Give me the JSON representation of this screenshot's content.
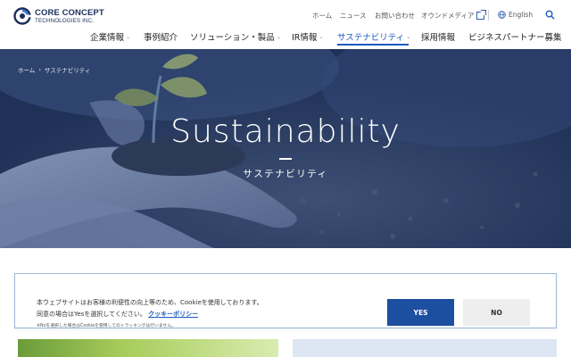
{
  "brand": {
    "line1": "CORE CONCEPT",
    "line2": "TECHNOLOGIES INC.",
    "logo_icon": "cct-logo-mark"
  },
  "utility_nav": {
    "home": "ホーム",
    "news": "ニュース",
    "contact": "お問い合わせ",
    "owned_media": "オウンドメディア",
    "owned_media_icon": "external-link-icon",
    "language": "English",
    "language_icon": "globe-icon",
    "search_icon": "search-icon"
  },
  "global_nav": [
    {
      "label": "企業情報",
      "has_dropdown": true,
      "active": false
    },
    {
      "label": "事例紹介",
      "has_dropdown": false,
      "active": false
    },
    {
      "label": "ソリューション・製品",
      "has_dropdown": true,
      "active": false
    },
    {
      "label": "IR情報",
      "has_dropdown": true,
      "active": false
    },
    {
      "label": "サステナビリティ",
      "has_dropdown": true,
      "active": true
    },
    {
      "label": "採用情報",
      "has_dropdown": false,
      "active": false
    },
    {
      "label": "ビジネスパートナー募集",
      "has_dropdown": false,
      "active": false
    }
  ],
  "breadcrumb": {
    "home": "ホーム",
    "separator": "›",
    "current": "サステナビリティ"
  },
  "hero": {
    "title": "Sustainability",
    "subtitle": "サステナビリティ"
  },
  "cookie_banner": {
    "text_line1": "本ウェブサイトはお客様の利便性の向上等のため、Cookieを使用しております。",
    "text_line2": "同意の場合はYesを選択してください。",
    "policy_link": "クッキーポリシー",
    "note": "※Noを選択した場合はCookieを使用してのトラッキングは行いません。",
    "yes_label": "YES",
    "no_label": "NO"
  },
  "colors": {
    "accent": "#1c5bbf",
    "brand_navy": "#1b2f5c",
    "yes_button": "#1d4fa0",
    "no_button": "#eeeeee",
    "hero_overlay": "#263a64"
  }
}
